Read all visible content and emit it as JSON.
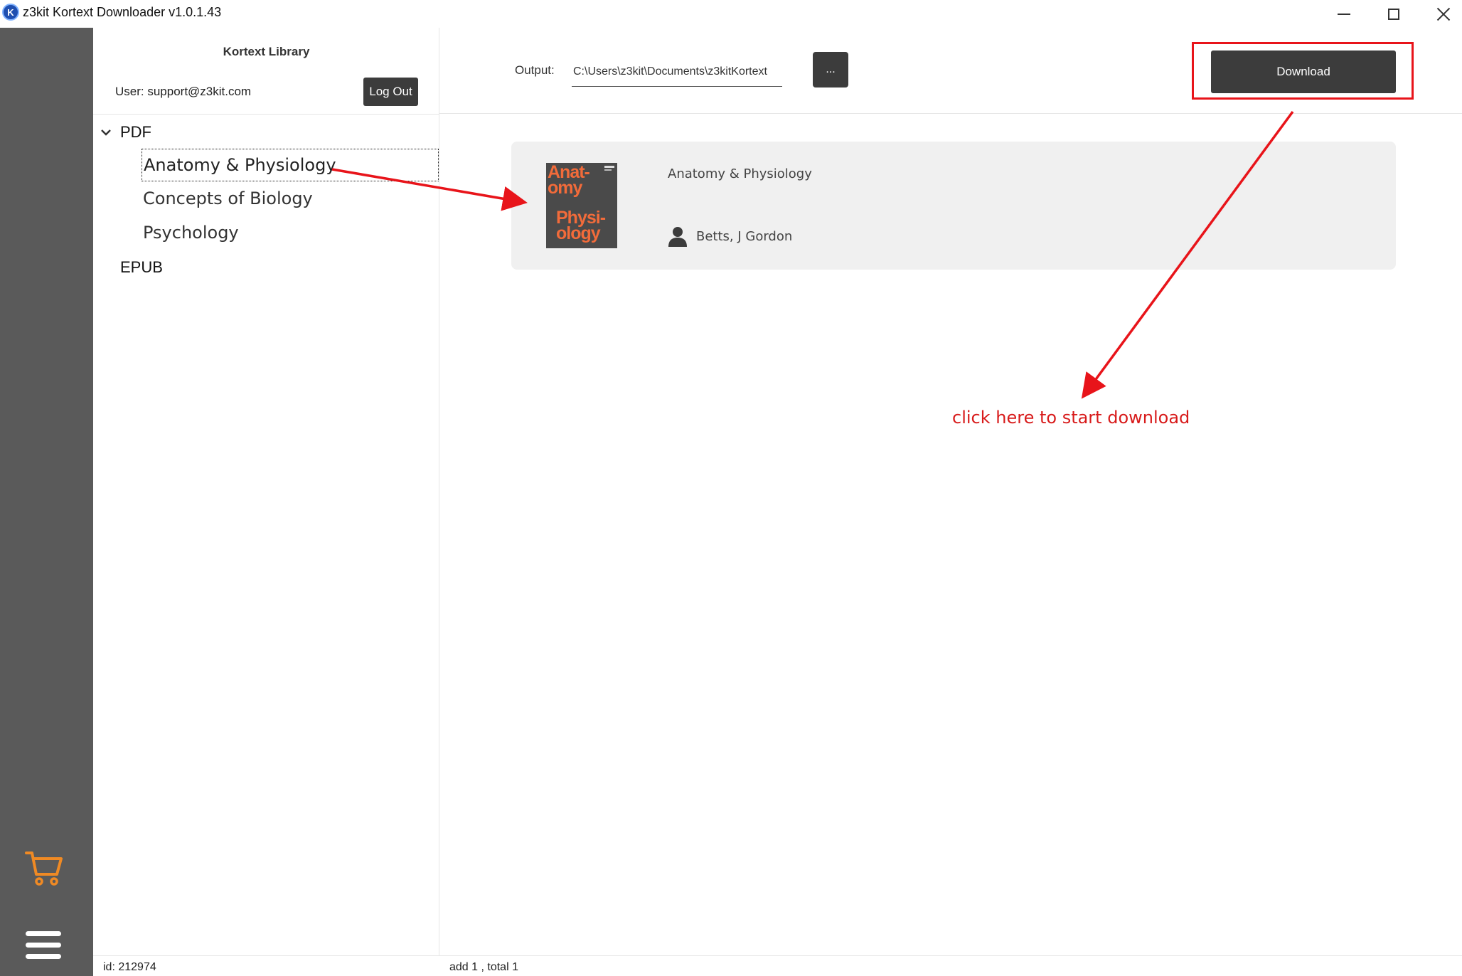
{
  "window": {
    "title": "z3kit Kortext Downloader v1.0.1.43",
    "icon_letter": "K"
  },
  "library": {
    "title": "Kortext Library",
    "user": "User: support@z3kit.com",
    "logout_label": "Log Out",
    "tree": {
      "pdf_label": "PDF",
      "pdf_items": [
        "Anatomy & Physiology",
        "Concepts of Biology",
        "Psychology"
      ],
      "epub_label": "EPUB"
    }
  },
  "toolbar": {
    "output_label": "Output:",
    "output_path": "C:\\Users\\z3kit\\Documents\\z3kitKortext",
    "browse_label": "...",
    "download_label": "Download"
  },
  "book": {
    "title": "Anatomy & Physiology",
    "author": "Betts, J Gordon",
    "cover_line1": "Anat-\nomy",
    "cover_line2": "Physi-\nology"
  },
  "annotation": {
    "text": "click here to start download"
  },
  "status": {
    "left": "id: 212974",
    "right": "add 1 , total 1"
  },
  "colors": {
    "accent_dark": "#3c3c3c",
    "rail": "#5a5a5a",
    "annotation_red": "#e8141a",
    "cart_orange": "#f08a24"
  },
  "icons": {
    "cart": "cart-icon",
    "menu": "hamburger-menu-icon",
    "author": "person-icon",
    "chevron": "chevron-down-icon"
  }
}
